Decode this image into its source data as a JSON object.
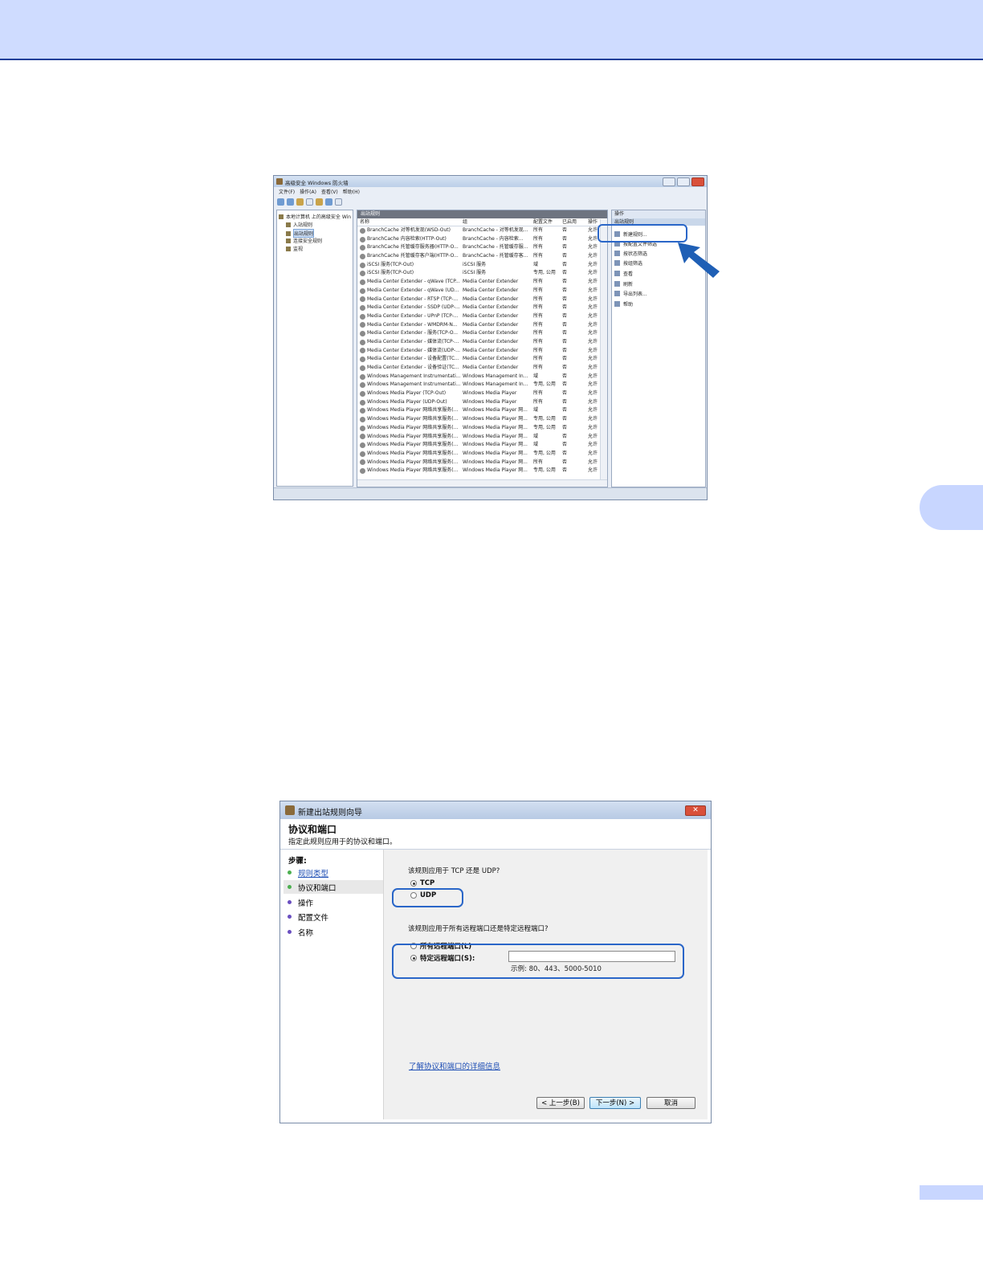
{
  "firewall": {
    "title": "高级安全 Windows 防火墙",
    "menu": [
      "文件(F)",
      "操作(A)",
      "查看(V)",
      "帮助(H)"
    ],
    "window_buttons": [
      "–",
      "□",
      "✕"
    ],
    "tree": {
      "root": "本地计算机 上的高级安全 Win",
      "items": [
        "入站规则",
        "出站规则",
        "连接安全规则",
        "监视"
      ],
      "selected": "出站规则"
    },
    "center": {
      "header": "出站规则",
      "columns": [
        "名称",
        "组",
        "配置文件",
        "已启用",
        "操作"
      ],
      "rows": [
        [
          "BranchCache 对等机发现(WSD-Out)",
          "BranchCache - 对等机发现...",
          "所有",
          "否",
          "允许"
        ],
        [
          "BranchCache 内容检索(HTTP-Out)",
          "BranchCache - 内容检索...",
          "所有",
          "否",
          "允许"
        ],
        [
          "BranchCache 托管缓存服务器(HTTP-O...",
          "BranchCache - 托管缓存服...",
          "所有",
          "否",
          "允许"
        ],
        [
          "BranchCache 托管缓存客户端(HTTP-O...",
          "BranchCache - 托管缓存客...",
          "所有",
          "否",
          "允许"
        ],
        [
          "iSCSI 服务(TCP-Out)",
          "iSCSI 服务",
          "域",
          "否",
          "允许"
        ],
        [
          "iSCSI 服务(TCP-Out)",
          "iSCSI 服务",
          "专用, 公用",
          "否",
          "允许"
        ],
        [
          "Media Center Extender - qWave (TCP...",
          "Media Center Extender",
          "所有",
          "否",
          "允许"
        ],
        [
          "Media Center Extender - qWave (UD...",
          "Media Center Extender",
          "所有",
          "否",
          "允许"
        ],
        [
          "Media Center Extender - RTSP (TCP-...",
          "Media Center Extender",
          "所有",
          "否",
          "允许"
        ],
        [
          "Media Center Extender - SSDP (UDP-...",
          "Media Center Extender",
          "所有",
          "否",
          "允许"
        ],
        [
          "Media Center Extender - UPnP (TCP-...",
          "Media Center Extender",
          "所有",
          "否",
          "允许"
        ],
        [
          "Media Center Extender - WMDRM-N...",
          "Media Center Extender",
          "所有",
          "否",
          "允许"
        ],
        [
          "Media Center Extender - 服务(TCP-O...",
          "Media Center Extender",
          "所有",
          "否",
          "允许"
        ],
        [
          "Media Center Extender - 媒体流(TCP-...",
          "Media Center Extender",
          "所有",
          "否",
          "允许"
        ],
        [
          "Media Center Extender - 媒体流(UDP-...",
          "Media Center Extender",
          "所有",
          "否",
          "允许"
        ],
        [
          "Media Center Extender - 设备配置(TC...",
          "Media Center Extender",
          "所有",
          "否",
          "允许"
        ],
        [
          "Media Center Extender - 设备验证(TC...",
          "Media Center Extender",
          "所有",
          "否",
          "允许"
        ],
        [
          "Windows Management Instrumentati...",
          "Windows Management In...",
          "域",
          "否",
          "允许"
        ],
        [
          "Windows Management Instrumentati...",
          "Windows Management In...",
          "专用, 公用",
          "否",
          "允许"
        ],
        [
          "Windows Media Player (TCP-Out)",
          "Windows Media Player",
          "所有",
          "否",
          "允许"
        ],
        [
          "Windows Media Player (UDP-Out)",
          "Windows Media Player",
          "所有",
          "否",
          "允许"
        ],
        [
          "Windows Media Player 网络共享服务(...",
          "Windows Media Player 网...",
          "域",
          "否",
          "允许"
        ],
        [
          "Windows Media Player 网络共享服务(...",
          "Windows Media Player 网...",
          "专用, 公用",
          "否",
          "允许"
        ],
        [
          "Windows Media Player 网络共享服务(...",
          "Windows Media Player 网...",
          "专用, 公用",
          "否",
          "允许"
        ],
        [
          "Windows Media Player 网络共享服务(...",
          "Windows Media Player 网...",
          "域",
          "否",
          "允许"
        ],
        [
          "Windows Media Player 网络共享服务(...",
          "Windows Media Player 网...",
          "域",
          "否",
          "允许"
        ],
        [
          "Windows Media Player 网络共享服务(...",
          "Windows Media Player 网...",
          "专用, 公用",
          "否",
          "允许"
        ],
        [
          "Windows Media Player 网络共享服务(...",
          "Windows Media Player 网...",
          "所有",
          "否",
          "允许"
        ],
        [
          "Windows Media Player 网络共享服务(...",
          "Windows Media Player 网...",
          "专用, 公用",
          "否",
          "允许"
        ]
      ]
    },
    "actions": {
      "header": "操作",
      "subheader": "出站规则",
      "items": [
        "新建规则...",
        "按配置文件筛选",
        "按状态筛选",
        "按组筛选",
        "查看",
        "刷新",
        "导出列表...",
        "帮助"
      ]
    }
  },
  "wizard": {
    "title": "新建出站规则向导",
    "close": "✕",
    "heading": "协议和端口",
    "subheading": "指定此规则应用于的协议和端口。",
    "steps_label": "步骤:",
    "steps": [
      "规则类型",
      "协议和端口",
      "操作",
      "配置文件",
      "名称"
    ],
    "current_step": "协议和端口",
    "q1": "该规则应用于 TCP 还是 UDP?",
    "protocols": [
      "TCP",
      "UDP"
    ],
    "q2": "该规则应用于所有远程端口还是特定远程端口?",
    "ports": [
      "所有远程端口(L)",
      "特定远程端口(S):"
    ],
    "port_value": "",
    "example": "示例: 80、443、5000-5010",
    "link": "了解协议和端口的详细信息",
    "buttons": {
      "back": "< 上一步(B)",
      "next": "下一步(N) >",
      "cancel": "取消"
    }
  },
  "colors": {
    "header_band": "#cfdcff",
    "header_rule": "#1f3f99",
    "highlight": "#2a66c8",
    "link": "#1f4fb5"
  }
}
